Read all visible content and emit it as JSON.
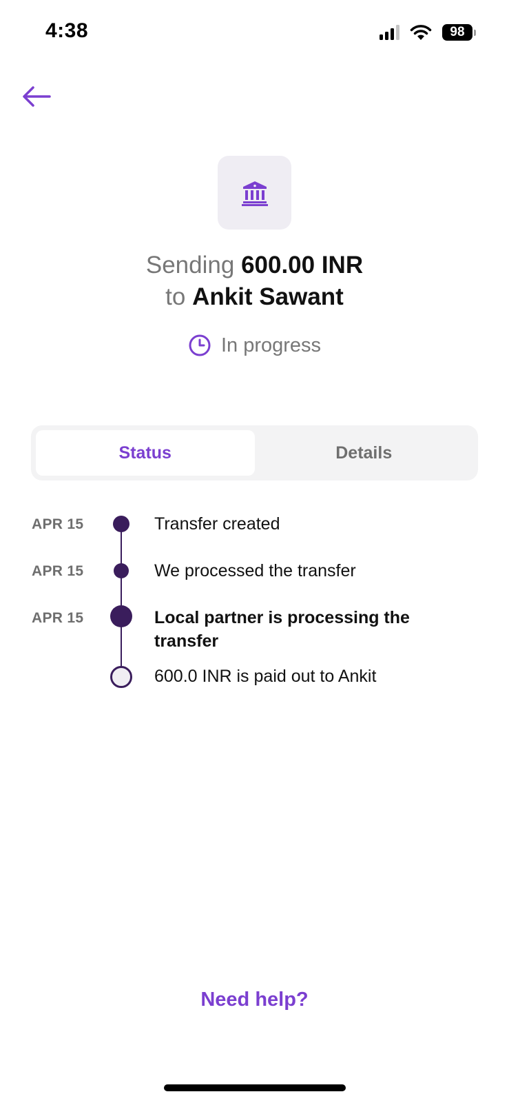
{
  "status_bar": {
    "time": "4:38",
    "battery": "98"
  },
  "header": {
    "back_icon": "arrow-left-icon"
  },
  "recipient": {
    "icon": "bank-icon",
    "sending_word": "Sending",
    "amount": "600.00 INR",
    "to_word": "to",
    "name": "Ankit Sawant"
  },
  "progress": {
    "icon": "clock-icon",
    "label": "In progress"
  },
  "tabs": [
    {
      "label": "Status",
      "active": true
    },
    {
      "label": "Details",
      "active": false
    }
  ],
  "timeline": [
    {
      "date": "APR 15",
      "text": "Transfer created",
      "state": "done"
    },
    {
      "date": "APR 15",
      "text": "We processed the transfer",
      "state": "done"
    },
    {
      "date": "APR 15",
      "text": "Local partner is processing the transfer",
      "state": "current"
    },
    {
      "date": "",
      "text": "600.0 INR is paid out to Ankit",
      "state": "pending"
    }
  ],
  "footer": {
    "help_label": "Need help?"
  },
  "colors": {
    "accent": "#7b3fd0",
    "timeline": "#3a1d5c",
    "muted": "#777777"
  }
}
